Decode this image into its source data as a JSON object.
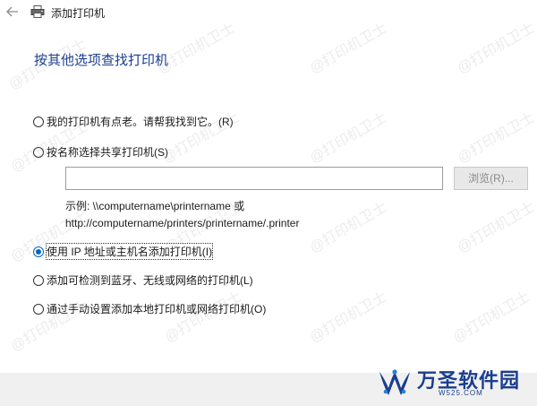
{
  "window": {
    "title": "添加打印机"
  },
  "page": {
    "heading": "按其他选项查找打印机"
  },
  "options": [
    {
      "label": "我的打印机有点老。请帮我找到它。(R)",
      "checked": false
    },
    {
      "label": "按名称选择共享打印机(S)",
      "checked": false
    },
    {
      "label": "使用 IP 地址或主机名添加打印机(I)",
      "checked": true
    },
    {
      "label": "添加可检测到蓝牙、无线或网络的打印机(L)",
      "checked": false
    },
    {
      "label": "通过手动设置添加本地打印机或网络打印机(O)",
      "checked": false
    }
  ],
  "share": {
    "input_value": "",
    "browse_label": "浏览(R)...",
    "example_line1": "示例: \\\\computername\\printername 或",
    "example_line2": "http://computername/printers/printername/.printer"
  },
  "watermark": {
    "text": "@打印机卫士"
  },
  "brand": {
    "name": "万圣软件园",
    "url": "W525.COM"
  },
  "colors": {
    "heading": "#1a3d8f",
    "radio_selected": "#0067c0",
    "footer_bg": "#f0f0f0"
  }
}
